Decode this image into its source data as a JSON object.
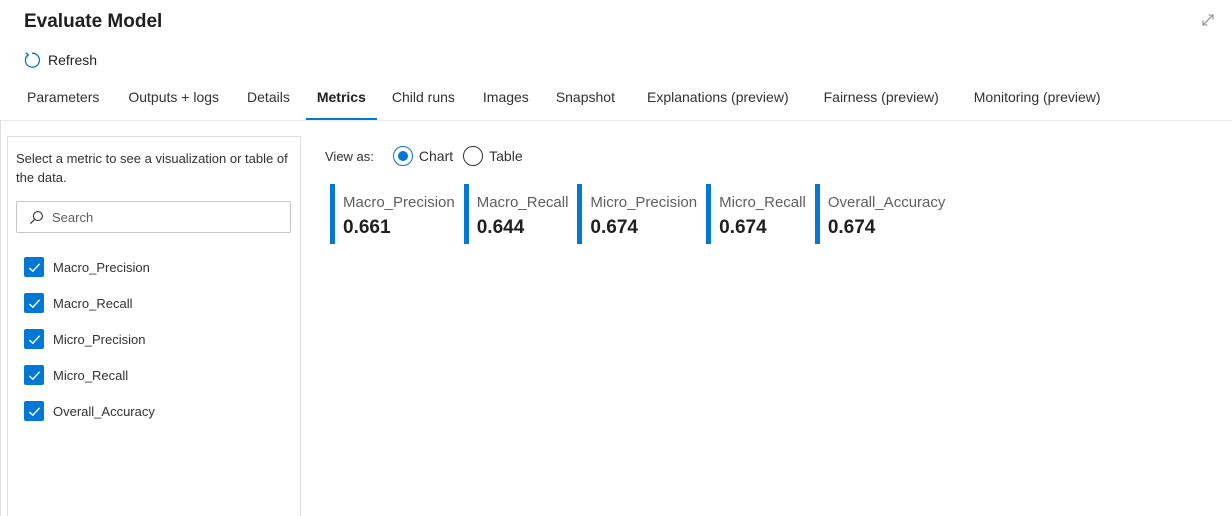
{
  "header": {
    "title": "Evaluate Model"
  },
  "toolbar": {
    "refresh_label": "Refresh"
  },
  "tabs": [
    {
      "label": "Parameters",
      "active": false
    },
    {
      "label": "Outputs + logs",
      "active": false
    },
    {
      "label": "Details",
      "active": false
    },
    {
      "label": "Metrics",
      "active": true
    },
    {
      "label": "Child runs",
      "active": false
    },
    {
      "label": "Images",
      "active": false
    },
    {
      "label": "Snapshot",
      "active": false
    },
    {
      "label": "Explanations (preview)",
      "active": false
    },
    {
      "label": "Fairness (preview)",
      "active": false
    },
    {
      "label": "Monitoring (preview)",
      "active": false
    }
  ],
  "left_panel": {
    "hint": "Select a metric to see a visualization or table of the data.",
    "search_placeholder": "Search",
    "metrics": [
      {
        "label": "Macro_Precision",
        "checked": true
      },
      {
        "label": "Macro_Recall",
        "checked": true
      },
      {
        "label": "Micro_Precision",
        "checked": true
      },
      {
        "label": "Micro_Recall",
        "checked": true
      },
      {
        "label": "Overall_Accuracy",
        "checked": true
      }
    ]
  },
  "view_as": {
    "label": "View as:",
    "options": [
      {
        "label": "Chart",
        "selected": true
      },
      {
        "label": "Table",
        "selected": false
      }
    ]
  },
  "cards": [
    {
      "name": "Macro_Precision",
      "value": "0.661"
    },
    {
      "name": "Macro_Recall",
      "value": "0.644"
    },
    {
      "name": "Micro_Precision",
      "value": "0.674"
    },
    {
      "name": "Micro_Recall",
      "value": "0.674"
    },
    {
      "name": "Overall_Accuracy",
      "value": "0.674"
    }
  ],
  "colors": {
    "accent": "#0078d4",
    "text": "#201f1e",
    "border": "#e1dfdd"
  },
  "icons": {
    "expand": "expand-diagonal-icon",
    "refresh": "refresh-icon",
    "search": "search-icon",
    "check": "checkmark-icon"
  }
}
